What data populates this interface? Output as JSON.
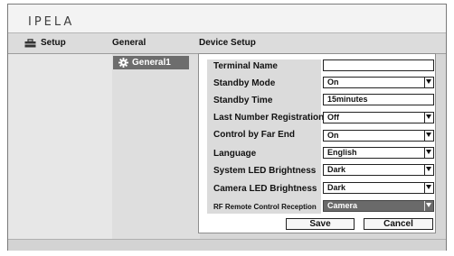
{
  "brand": {
    "logo": "IPELA"
  },
  "nav": {
    "setup_label": "Setup",
    "general_label": "General",
    "device_setup_label": "Device Setup"
  },
  "sidebar": {
    "selected_label": "General1"
  },
  "settings": {
    "terminal_name": {
      "label": "Terminal Name",
      "value": ""
    },
    "standby_mode": {
      "label": "Standby Mode",
      "value": "On"
    },
    "standby_time": {
      "label": "Standby Time",
      "value": "15minutes"
    },
    "last_number_registration": {
      "label": "Last Number Registration",
      "value": "Off"
    },
    "control_by_far_end": {
      "label": "Control by Far End",
      "value": "On"
    },
    "language": {
      "label": "Language",
      "value": "English"
    },
    "system_led_brightness": {
      "label": "System LED Brightness",
      "value": "Dark"
    },
    "camera_led_brightness": {
      "label": "Camera LED Brightness",
      "value": "Dark"
    },
    "rf_remote_control_reception": {
      "label": "RF Remote Control Reception",
      "value": "Camera"
    }
  },
  "buttons": {
    "save": "Save",
    "cancel": "Cancel"
  },
  "icons": {
    "setup": "toolbox-icon",
    "general1": "gear-icon",
    "dropdown": "chevron-down-icon"
  },
  "colors": {
    "selected_bg": "#6d6d6d",
    "focused_field_bg": "#6a6a6a"
  }
}
